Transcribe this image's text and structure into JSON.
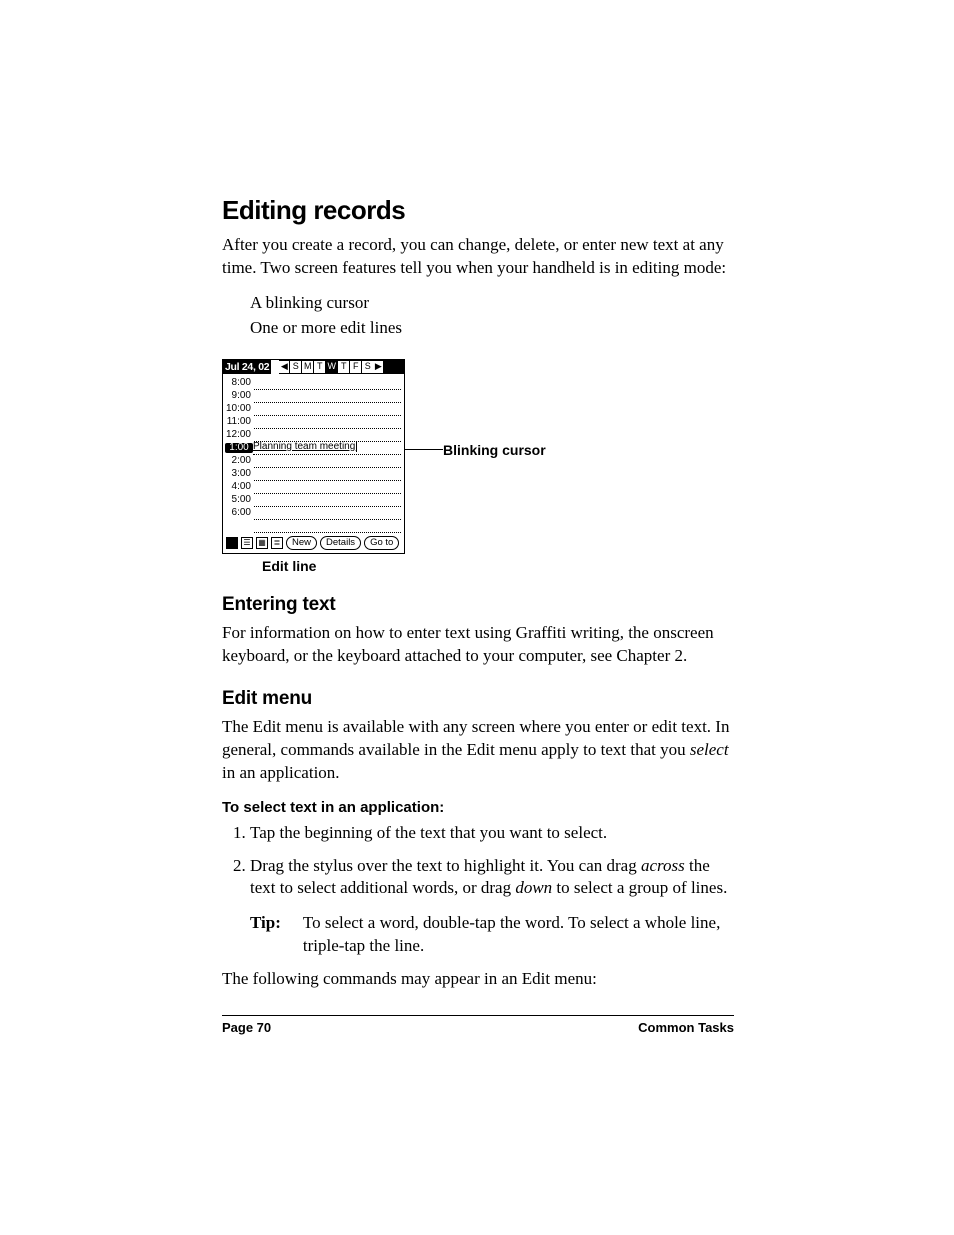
{
  "headings": {
    "h1": "Editing records",
    "h2_entering": "Entering text",
    "h2_editmenu": "Edit menu",
    "proc_heading": "To select text in an application:"
  },
  "paragraphs": {
    "intro": "After you create a record, you can change, delete, or enter new text at any time. Two screen features tell you when your handheld is in editing mode:",
    "entering_text": "For information on how to enter text using Graffiti writing, the onscreen keyboard, or the keyboard attached to your computer, see Chapter 2.",
    "editmenu_intro_1": "The Edit menu is available with any screen where you enter or edit text. In general, commands available in the Edit menu apply to text that you ",
    "editmenu_intro_italic": "select",
    "editmenu_intro_2": " in an application.",
    "closing": "The following commands may appear in an Edit menu:"
  },
  "feature_items": {
    "a": "A blinking cursor",
    "b": "One or more edit lines"
  },
  "figure": {
    "date": "Jul 24, 02",
    "days": [
      "S",
      "M",
      "T",
      "W",
      "T",
      "F",
      "S"
    ],
    "selected_day_index": 3,
    "times": [
      "8:00",
      "9:00",
      "10:00",
      "11:00",
      "12:00",
      "1:00",
      "2:00",
      "3:00",
      "4:00",
      "5:00",
      "6:00"
    ],
    "selected_time_index": 5,
    "entry_text": "Planning team meeting",
    "buttons": {
      "new": "New",
      "details": "Details",
      "goto": "Go to"
    },
    "callout_cursor": "Blinking cursor",
    "callout_editline": "Edit line"
  },
  "steps": {
    "s1": "Tap the beginning of the text that you want to select.",
    "s2_a": "Drag the stylus over the text to highlight it. You can drag ",
    "s2_i1": "across",
    "s2_b": " the text to select additional words, or drag ",
    "s2_i2": "down",
    "s2_c": " to select a group of lines.",
    "tip_label": "Tip:",
    "tip_text": "To select a word, double-tap the word. To select a whole line, triple-tap the line."
  },
  "footer": {
    "left": "Page 70",
    "right": "Common Tasks"
  }
}
